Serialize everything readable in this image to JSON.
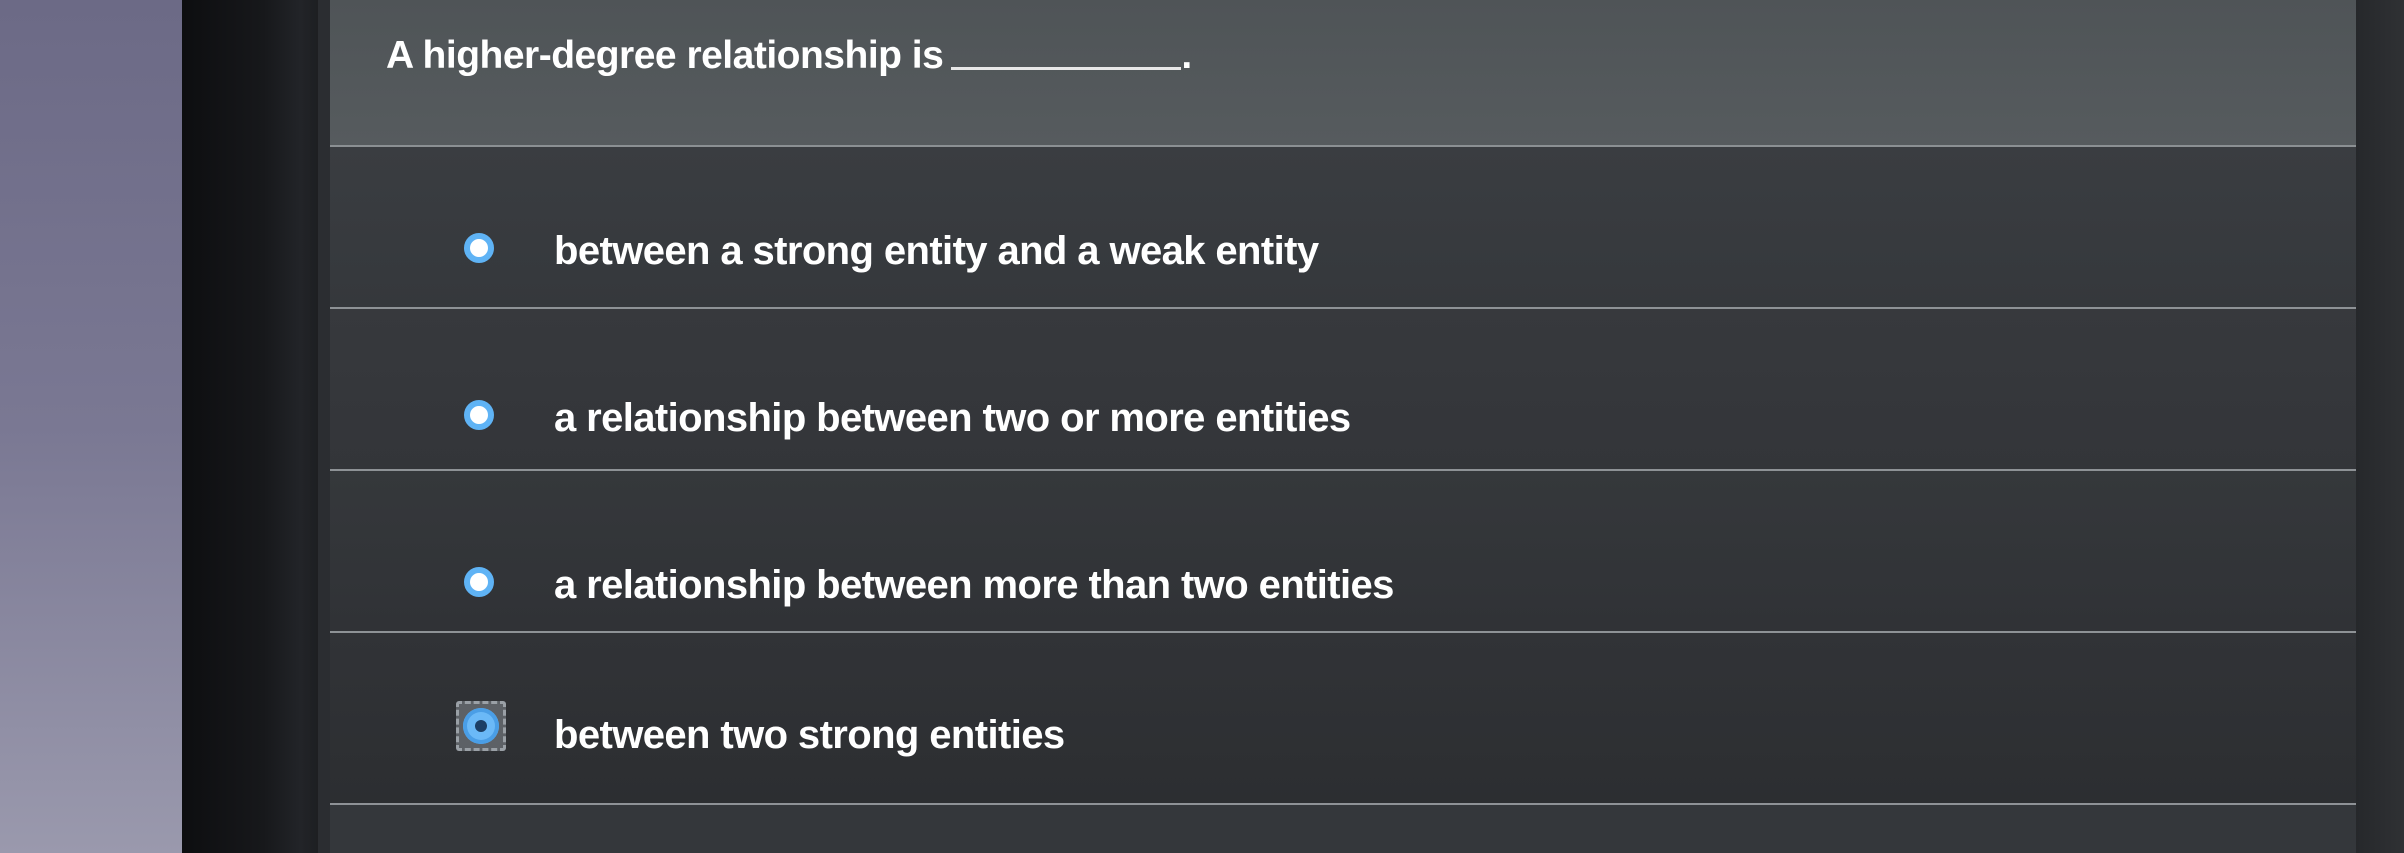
{
  "question": {
    "text": "A higher-degree relationship is",
    "blank_suffix": "."
  },
  "options": [
    {
      "label": "between a strong entity and a weak entity",
      "selected": false
    },
    {
      "label": "a relationship between two or more entities",
      "selected": false
    },
    {
      "label": "a relationship between more than two entities",
      "selected": false
    },
    {
      "label": "between two strong entities",
      "selected": true
    }
  ],
  "colors": {
    "radio_accent": "#5fb3f5",
    "card_background": "#34373b",
    "text": "#ffffff"
  }
}
